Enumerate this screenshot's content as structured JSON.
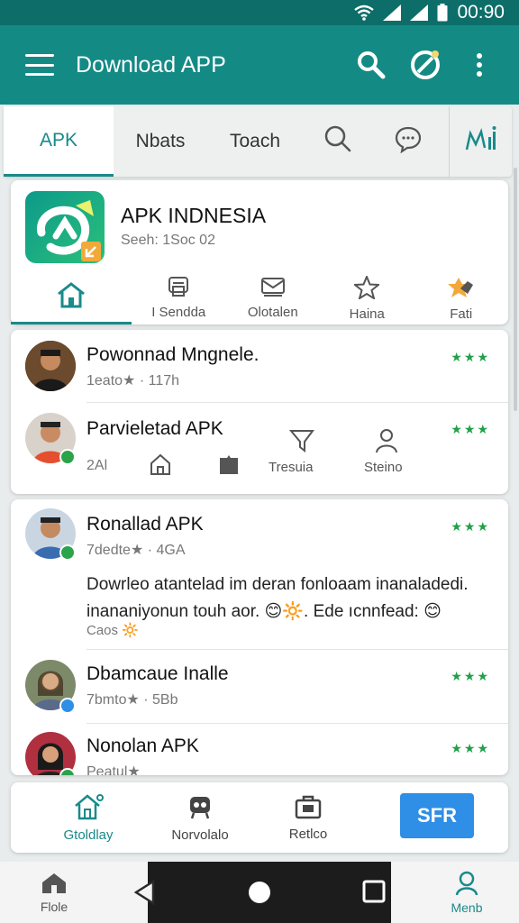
{
  "status": {
    "time": "00:90"
  },
  "appbar": {
    "title": "Download APP",
    "icons": [
      "menu-icon",
      "search-icon",
      "compass-icon",
      "more-vert-icon"
    ]
  },
  "tabs": [
    {
      "label": "APK",
      "active": true
    },
    {
      "label": "Nbats"
    },
    {
      "label": "Toach"
    },
    {
      "icon": "search-icon"
    },
    {
      "icon": "chat-icon"
    },
    {
      "icon": "signal-icon"
    }
  ],
  "app": {
    "name": "APK INDNESIA",
    "sub": "Seeh: 1Soc 02",
    "actions": [
      {
        "icon": "home-icon",
        "label": ""
      },
      {
        "icon": "device-icon",
        "label": "I Sendda"
      },
      {
        "icon": "mail-icon",
        "label": "Olotalen"
      },
      {
        "icon": "star-icon",
        "label": "Haina"
      },
      {
        "icon": "puzzle-icon",
        "label": "Fati"
      }
    ]
  },
  "feed1": [
    {
      "name": "Powonnad Mngnele.",
      "meta": "1eato★ · 117h",
      "stars": "★★★"
    },
    {
      "name": "Parvieletad APK",
      "meta": "2Al",
      "stars": "★★★",
      "actions": [
        "Tresuia",
        "Steino"
      ]
    }
  ],
  "feed2": [
    {
      "name": "Ronallad APK",
      "meta": "7dedte★ · 4GA",
      "stars": "★★★",
      "body1": "Dowrleo atantelad im deran fonloaam inanaladedi.",
      "body2": "inananiyonun touh aor. 😊🔆. Ede ıcnnfead: 😊",
      "body3": "Caos 🔆"
    },
    {
      "name": "Dbamcaue Inalle",
      "meta": "7bmto★ · 5Bb",
      "stars": "★★★"
    },
    {
      "name": "Nonolan APK",
      "meta": "Peatul★",
      "stars": "★★★"
    }
  ],
  "bottom": {
    "items": [
      {
        "icon": "home-icon",
        "label": "Gtoldlay"
      },
      {
        "icon": "robot-icon",
        "label": "Norvolalo"
      },
      {
        "icon": "briefcase-icon",
        "label": "Retlco"
      }
    ],
    "button": "SFR"
  },
  "sysnav": {
    "left": "Flole",
    "right": "Menb"
  },
  "colors": {
    "primary": "#148a85",
    "accent": "#1a8a8a",
    "star": "#21a04a",
    "button": "#2f8ee6"
  }
}
